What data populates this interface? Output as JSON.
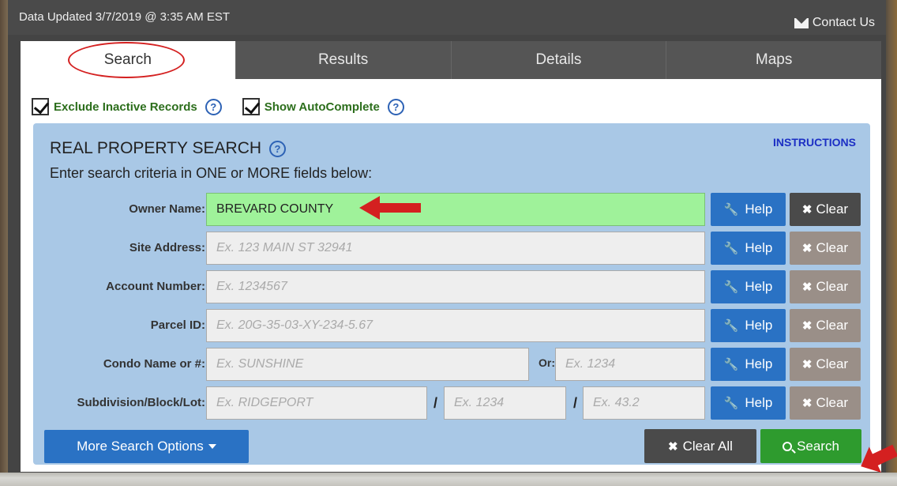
{
  "header": {
    "updated_text": "Data Updated 3/7/2019 @ 3:35 AM EST",
    "contact_label": "Contact Us",
    "contact_icon": "mail-icon"
  },
  "tabs": [
    {
      "label": "Search",
      "active": true
    },
    {
      "label": "Results",
      "active": false
    },
    {
      "label": "Details",
      "active": false
    },
    {
      "label": "Maps",
      "active": false
    }
  ],
  "options": {
    "exclude_inactive": {
      "label": "Exclude Inactive Records",
      "checked": true
    },
    "show_autocomplete": {
      "label": "Show AutoComplete",
      "checked": true
    },
    "help_glyph": "?"
  },
  "search": {
    "title": "REAL PROPERTY SEARCH",
    "subtitle": "Enter search criteria in ONE or MORE fields below:",
    "instructions_label": "INSTRUCTIONS",
    "help_label": "Help",
    "clear_label": "Clear",
    "fields": {
      "owner": {
        "label": "Owner Name:",
        "value": "BREVARD COUNTY"
      },
      "site": {
        "label": "Site Address:",
        "placeholder": "Ex. 123 MAIN ST 32941"
      },
      "account": {
        "label": "Account Number:",
        "placeholder": "Ex. 1234567"
      },
      "parcel": {
        "label": "Parcel ID:",
        "placeholder": "Ex. 20G-35-03-XY-234-5.67"
      },
      "condo": {
        "label": "Condo Name or #:",
        "placeholder": "Ex. SUNSHINE",
        "or_label": "Or:",
        "or_placeholder": "Ex. 1234"
      },
      "subdivision": {
        "label": "Subdivision/Block/Lot:",
        "placeholder": "Ex. RIDGEPORT",
        "block_placeholder": "Ex. 1234",
        "lot_placeholder": "Ex. 43.2",
        "separator": "/"
      }
    },
    "more_options_label": "More Search Options",
    "clear_all_label": "Clear All",
    "search_label": "Search"
  },
  "colors": {
    "help_blue": "#2a72c4",
    "search_green": "#2e9b2e",
    "filled_field": "#9ff29a",
    "annotation_red": "#d42020"
  }
}
